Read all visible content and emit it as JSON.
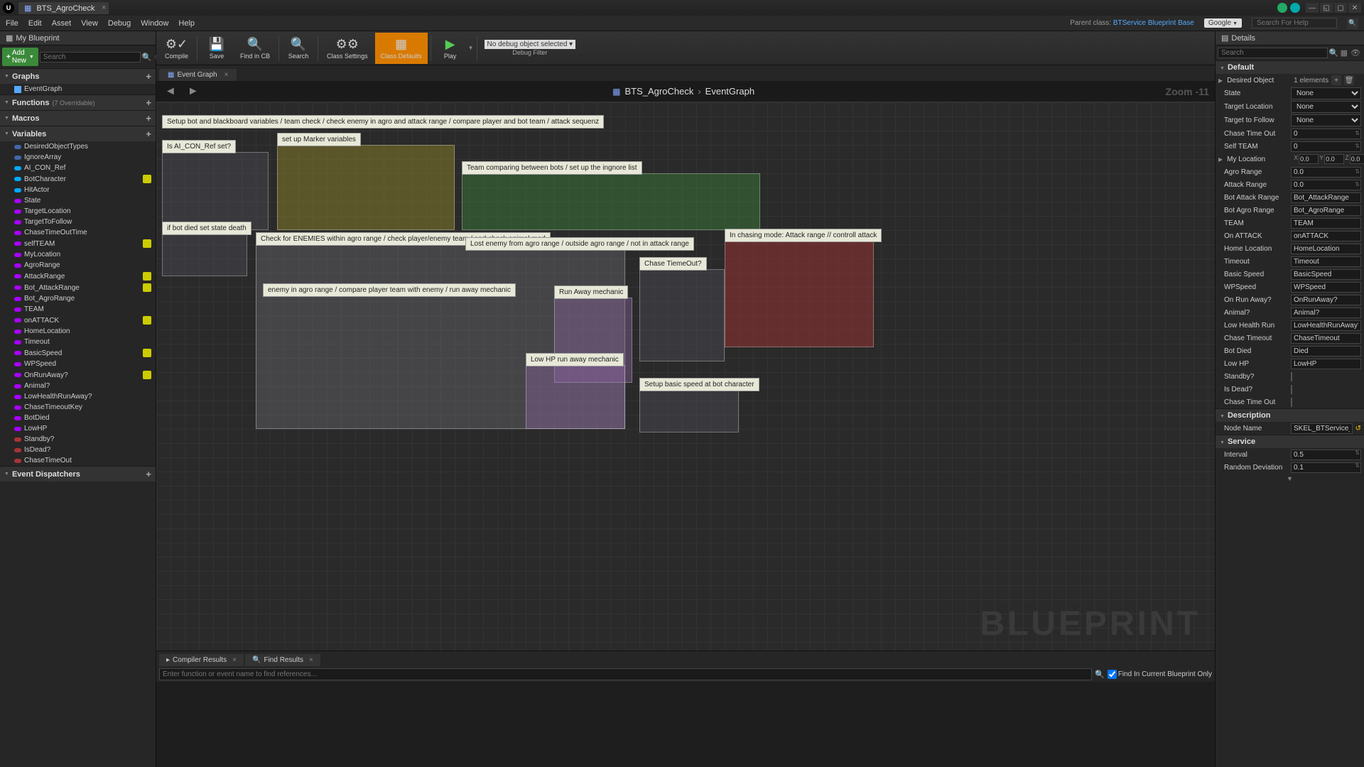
{
  "titlebar": {
    "tab_name": "BTS_AgroCheck"
  },
  "menu": {
    "file": "File",
    "edit": "Edit",
    "asset": "Asset",
    "view": "View",
    "debug": "Debug",
    "window": "Window",
    "help": "Help",
    "parent_label": "Parent class:",
    "parent_class": "BTService Blueprint Base",
    "search_engine": "Google",
    "help_placeholder": "Search For Help"
  },
  "toolbar": {
    "compile": "Compile",
    "save": "Save",
    "find_cb": "Find in CB",
    "search": "Search",
    "class_settings": "Class Settings",
    "class_defaults": "Class Defaults",
    "play": "Play",
    "debug_none": "No debug object selected",
    "debug_filter": "Debug Filter"
  },
  "left": {
    "panel": "My Blueprint",
    "add_new": "Add New",
    "search_ph": "Search",
    "cat_graphs": "Graphs",
    "eventgraph": "EventGraph",
    "cat_functions": "Functions",
    "functions_sub": "(7 Overridable)",
    "cat_macros": "Macros",
    "cat_variables": "Variables",
    "cat_dispatch": "Event Dispatchers",
    "vars": [
      {
        "name": "DesiredObjectTypes",
        "c": "#46a",
        "vis": false
      },
      {
        "name": "IgnoreArray",
        "c": "#46a",
        "vis": false
      },
      {
        "name": "AI_CON_Ref",
        "c": "#0af",
        "vis": false
      },
      {
        "name": "BotCharacter",
        "c": "#0af",
        "vis": true
      },
      {
        "name": "HitActor",
        "c": "#0af",
        "vis": false
      },
      {
        "name": "State",
        "c": "#a0f",
        "vis": false
      },
      {
        "name": "TargetLocation",
        "c": "#a0f",
        "vis": false
      },
      {
        "name": "TargetToFollow",
        "c": "#a0f",
        "vis": false
      },
      {
        "name": "ChaseTimeOutTime",
        "c": "#a0f",
        "vis": false
      },
      {
        "name": "selfTEAM",
        "c": "#a0f",
        "vis": true
      },
      {
        "name": "MyLocation",
        "c": "#a0f",
        "vis": false
      },
      {
        "name": "AgroRange",
        "c": "#a0f",
        "vis": false
      },
      {
        "name": "AttackRange",
        "c": "#a0f",
        "vis": true
      },
      {
        "name": "Bot_AttackRange",
        "c": "#a0f",
        "vis": true
      },
      {
        "name": "Bot_AgroRange",
        "c": "#a0f",
        "vis": false
      },
      {
        "name": "TEAM",
        "c": "#a0f",
        "vis": false
      },
      {
        "name": "onATTACK",
        "c": "#a0f",
        "vis": true
      },
      {
        "name": "HomeLocation",
        "c": "#a0f",
        "vis": false
      },
      {
        "name": "Timeout",
        "c": "#a0f",
        "vis": false
      },
      {
        "name": "BasicSpeed",
        "c": "#a0f",
        "vis": true
      },
      {
        "name": "WPSpeed",
        "c": "#a0f",
        "vis": false
      },
      {
        "name": "OnRunAway?",
        "c": "#a0f",
        "vis": true
      },
      {
        "name": "Animal?",
        "c": "#a0f",
        "vis": false
      },
      {
        "name": "LowHealthRunAway?",
        "c": "#a0f",
        "vis": false
      },
      {
        "name": "ChaseTimeoutKey",
        "c": "#a0f",
        "vis": false
      },
      {
        "name": "BotDied",
        "c": "#a0f",
        "vis": false
      },
      {
        "name": "LowHP",
        "c": "#a0f",
        "vis": false
      },
      {
        "name": "Standby?",
        "c": "#a33",
        "vis": false
      },
      {
        "name": "IsDead?",
        "c": "#a33",
        "vis": false
      },
      {
        "name": "ChaseTimeOut",
        "c": "#a33",
        "vis": false
      }
    ]
  },
  "graph": {
    "tab": "Event Graph",
    "breadcrumb_root": "BTS_AgroCheck",
    "breadcrumb_leaf": "EventGraph",
    "zoom": "Zoom -11",
    "watermark": "BLUEPRINT",
    "comments": {
      "main": "Setup bot and blackboard variables / team check / check enemy in agro and attack range / compare player and bot team / attack sequenz",
      "aicon": "Is AI_CON_Ref set?",
      "marker": "set up Marker variables",
      "botdied": "if bot died set state death",
      "team": "Team comparing between bots / set up the ingnore list",
      "enemies": "Check for ENEMIES within agro range / check player/enemy team / and check animal mod",
      "lost": "Lost enemy from agro range / outside agro range / not in attack range",
      "agro": "enemy in agro range / compare player team with enemy / run away mechanic",
      "runaway": "Run Away mechanic",
      "lowhp": "Low HP run away mechanic",
      "chase": "Chase TiemeOut?",
      "basicspeed": "Setup basic speed at bot character",
      "chasing": "In chasing mode: Attack range // controll attack"
    }
  },
  "bottom": {
    "compiler": "Compiler Results",
    "find": "Find Results",
    "find_ph": "Enter function or event name to find references...",
    "find_scope": "Find In Current Blueprint Only"
  },
  "right": {
    "panel": "Details",
    "search_ph": "Search",
    "cat_default": "Default",
    "cat_desc": "Description",
    "cat_service": "Service",
    "desired_obj": "Desired Object",
    "desired_obj_val": "1 elements",
    "rows": [
      {
        "label": "State",
        "type": "select",
        "value": "None"
      },
      {
        "label": "Target Location",
        "type": "select",
        "value": "None"
      },
      {
        "label": "Target to Follow",
        "type": "select",
        "value": "None"
      },
      {
        "label": "Chase Time Out",
        "type": "num",
        "value": "0"
      },
      {
        "label": "Self TEAM",
        "type": "num",
        "value": "0"
      },
      {
        "label": "My Location",
        "type": "vec3",
        "value": "0.0"
      },
      {
        "label": "Agro Range",
        "type": "num",
        "value": "0.0"
      },
      {
        "label": "Attack Range",
        "type": "num",
        "value": "0.0"
      },
      {
        "label": "Bot Attack Range",
        "type": "text",
        "value": "Bot_AttackRange"
      },
      {
        "label": "Bot Agro Range",
        "type": "text",
        "value": "Bot_AgroRange"
      },
      {
        "label": "TEAM",
        "type": "text",
        "value": "TEAM"
      },
      {
        "label": "On ATTACK",
        "type": "text",
        "value": "onATTACK"
      },
      {
        "label": "Home Location",
        "type": "text",
        "value": "HomeLocation"
      },
      {
        "label": "Timeout",
        "type": "text",
        "value": "Timeout"
      },
      {
        "label": "Basic Speed",
        "type": "text",
        "value": "BasicSpeed"
      },
      {
        "label": "WPSpeed",
        "type": "text",
        "value": "WPSpeed"
      },
      {
        "label": "On Run Away?",
        "type": "text",
        "value": "OnRunAway?"
      },
      {
        "label": "Animal?",
        "type": "text",
        "value": "Animal?"
      },
      {
        "label": "Low Health Run",
        "type": "text",
        "value": "LowHealthRunAway?"
      },
      {
        "label": "Chase Timeout",
        "type": "text",
        "value": "ChaseTimeout"
      },
      {
        "label": "Bot Died",
        "type": "text",
        "value": "Died"
      },
      {
        "label": "Low HP",
        "type": "text",
        "value": "LowHP"
      },
      {
        "label": "Standby?",
        "type": "check",
        "value": ""
      },
      {
        "label": "Is Dead?",
        "type": "check",
        "value": ""
      },
      {
        "label": "Chase Time Out",
        "type": "check",
        "value": ""
      }
    ],
    "node_name_lbl": "Node Name",
    "node_name": "SKEL_BTService_BlueprintBase",
    "interval_lbl": "Interval",
    "interval": "0.5",
    "random_lbl": "Random Deviation",
    "random": "0.1"
  }
}
